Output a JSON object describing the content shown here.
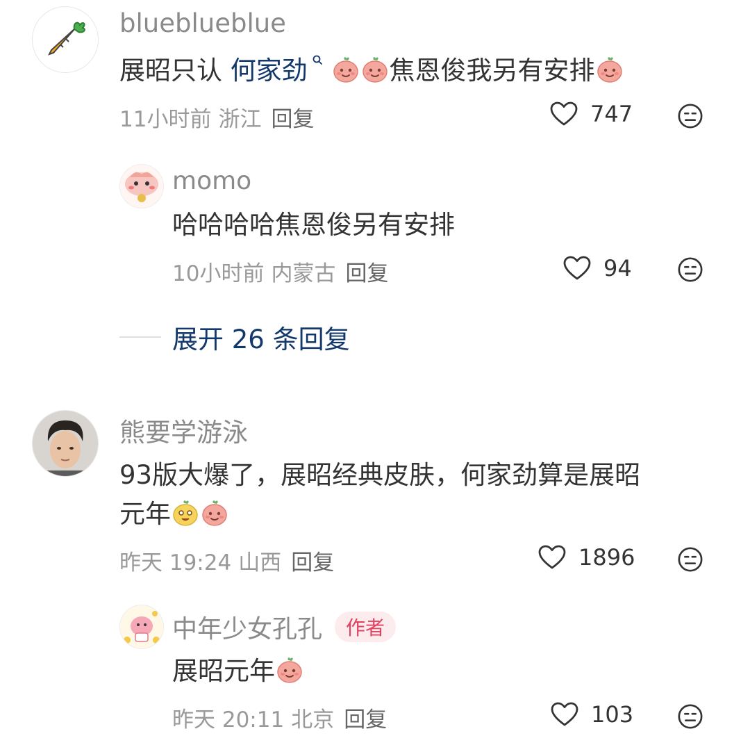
{
  "comments": [
    {
      "username": "blueblueblue",
      "text_before": "展昭只认 ",
      "mention": "何家劲",
      "text_after": "焦恩俊我另有安排",
      "time": "11小时前",
      "region": "浙江",
      "reply_label": "回复",
      "likes": "747",
      "replies": [
        {
          "username": "momo",
          "text": "哈哈哈哈焦恩俊另有安排",
          "time": "10小时前",
          "region": "内蒙古",
          "reply_label": "回复",
          "likes": "94"
        }
      ],
      "expand_label": "展开 26 条回复"
    },
    {
      "username": "熊要学游泳",
      "text_line1": "93版大爆了，展昭经典皮肤，何家劲算是展昭",
      "text_line2": "元年",
      "time": "昨天 19:24",
      "region": "山西",
      "reply_label": "回复",
      "likes": "1896",
      "replies": [
        {
          "username": "中年少女孔孔",
          "badge": "作者",
          "text": "展昭元年",
          "time": "昨天 20:11",
          "region": "北京",
          "reply_label": "回复",
          "likes": "103"
        }
      ]
    }
  ],
  "icons": {
    "like": "heart-outline-icon",
    "dislike": "neutral-face-icon",
    "mention": "search-icon"
  },
  "colors": {
    "mention": "#13386c",
    "badge_bg": "#fdecee",
    "badge_text": "#e4405f",
    "emoji": "#f4a79c"
  }
}
